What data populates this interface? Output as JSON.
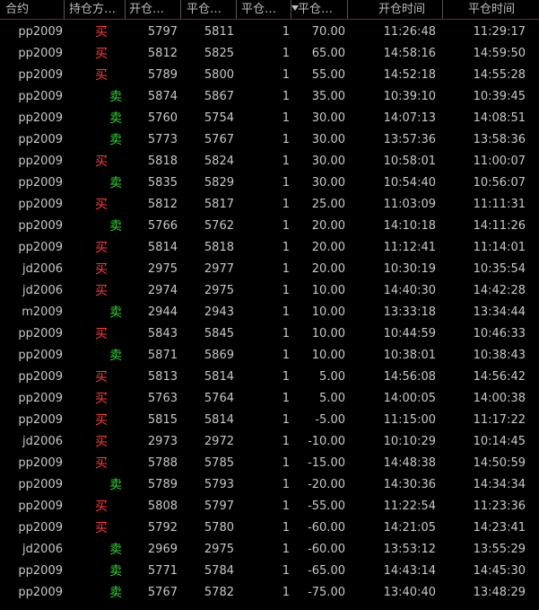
{
  "headers": {
    "contract": "合约",
    "direction": "持仓方…",
    "open_price": "开仓…",
    "close_price": "平仓…",
    "quantity": "平仓…",
    "pnl": "平仓…",
    "open_time": "开仓时间",
    "close_time": "平仓时间"
  },
  "icons": {
    "sort": "sort-descending-icon"
  },
  "colors": {
    "buy": "#ff3b3b",
    "sell": "#2fd32f",
    "header_border": "#8a1a1a"
  },
  "rows": [
    {
      "contract": "pp2009",
      "dir": "买",
      "side": "buy",
      "open": "5797",
      "close": "5811",
      "qty": "1",
      "pnl": "70.00",
      "otime": "11:26:48",
      "ctime": "11:29:17"
    },
    {
      "contract": "pp2009",
      "dir": "买",
      "side": "buy",
      "open": "5812",
      "close": "5825",
      "qty": "1",
      "pnl": "65.00",
      "otime": "14:58:16",
      "ctime": "14:59:50"
    },
    {
      "contract": "pp2009",
      "dir": "买",
      "side": "buy",
      "open": "5789",
      "close": "5800",
      "qty": "1",
      "pnl": "55.00",
      "otime": "14:52:18",
      "ctime": "14:55:28"
    },
    {
      "contract": "pp2009",
      "dir": "卖",
      "side": "sell",
      "open": "5874",
      "close": "5867",
      "qty": "1",
      "pnl": "35.00",
      "otime": "10:39:10",
      "ctime": "10:39:45"
    },
    {
      "contract": "pp2009",
      "dir": "卖",
      "side": "sell",
      "open": "5760",
      "close": "5754",
      "qty": "1",
      "pnl": "30.00",
      "otime": "14:07:13",
      "ctime": "14:08:51"
    },
    {
      "contract": "pp2009",
      "dir": "卖",
      "side": "sell",
      "open": "5773",
      "close": "5767",
      "qty": "1",
      "pnl": "30.00",
      "otime": "13:57:36",
      "ctime": "13:58:36"
    },
    {
      "contract": "pp2009",
      "dir": "买",
      "side": "buy",
      "open": "5818",
      "close": "5824",
      "qty": "1",
      "pnl": "30.00",
      "otime": "10:58:01",
      "ctime": "11:00:07"
    },
    {
      "contract": "pp2009",
      "dir": "卖",
      "side": "sell",
      "open": "5835",
      "close": "5829",
      "qty": "1",
      "pnl": "30.00",
      "otime": "10:54:40",
      "ctime": "10:56:07"
    },
    {
      "contract": "pp2009",
      "dir": "买",
      "side": "buy",
      "open": "5812",
      "close": "5817",
      "qty": "1",
      "pnl": "25.00",
      "otime": "11:03:09",
      "ctime": "11:11:31"
    },
    {
      "contract": "pp2009",
      "dir": "卖",
      "side": "sell",
      "open": "5766",
      "close": "5762",
      "qty": "1",
      "pnl": "20.00",
      "otime": "14:10:18",
      "ctime": "14:11:26"
    },
    {
      "contract": "pp2009",
      "dir": "买",
      "side": "buy",
      "open": "5814",
      "close": "5818",
      "qty": "1",
      "pnl": "20.00",
      "otime": "11:12:41",
      "ctime": "11:14:01"
    },
    {
      "contract": "jd2006",
      "dir": "买",
      "side": "buy",
      "open": "2975",
      "close": "2977",
      "qty": "1",
      "pnl": "20.00",
      "otime": "10:30:19",
      "ctime": "10:35:54"
    },
    {
      "contract": "jd2006",
      "dir": "买",
      "side": "buy",
      "open": "2974",
      "close": "2975",
      "qty": "1",
      "pnl": "10.00",
      "otime": "14:40:30",
      "ctime": "14:42:28"
    },
    {
      "contract": "m2009",
      "dir": "卖",
      "side": "sell",
      "open": "2944",
      "close": "2943",
      "qty": "1",
      "pnl": "10.00",
      "otime": "13:33:18",
      "ctime": "13:34:44"
    },
    {
      "contract": "pp2009",
      "dir": "买",
      "side": "buy",
      "open": "5843",
      "close": "5845",
      "qty": "1",
      "pnl": "10.00",
      "otime": "10:44:59",
      "ctime": "10:46:33"
    },
    {
      "contract": "pp2009",
      "dir": "卖",
      "side": "sell",
      "open": "5871",
      "close": "5869",
      "qty": "1",
      "pnl": "10.00",
      "otime": "10:38:01",
      "ctime": "10:38:43"
    },
    {
      "contract": "pp2009",
      "dir": "买",
      "side": "buy",
      "open": "5813",
      "close": "5814",
      "qty": "1",
      "pnl": "5.00",
      "otime": "14:56:08",
      "ctime": "14:56:42"
    },
    {
      "contract": "pp2009",
      "dir": "买",
      "side": "buy",
      "open": "5763",
      "close": "5764",
      "qty": "1",
      "pnl": "5.00",
      "otime": "14:00:05",
      "ctime": "14:00:38"
    },
    {
      "contract": "pp2009",
      "dir": "买",
      "side": "buy",
      "open": "5815",
      "close": "5814",
      "qty": "1",
      "pnl": "-5.00",
      "otime": "11:15:00",
      "ctime": "11:17:22"
    },
    {
      "contract": "jd2006",
      "dir": "买",
      "side": "buy",
      "open": "2973",
      "close": "2972",
      "qty": "1",
      "pnl": "-10.00",
      "otime": "10:10:29",
      "ctime": "10:14:45"
    },
    {
      "contract": "pp2009",
      "dir": "买",
      "side": "buy",
      "open": "5788",
      "close": "5785",
      "qty": "1",
      "pnl": "-15.00",
      "otime": "14:48:38",
      "ctime": "14:50:59"
    },
    {
      "contract": "pp2009",
      "dir": "卖",
      "side": "sell",
      "open": "5789",
      "close": "5793",
      "qty": "1",
      "pnl": "-20.00",
      "otime": "14:30:36",
      "ctime": "14:34:34"
    },
    {
      "contract": "pp2009",
      "dir": "买",
      "side": "buy",
      "open": "5808",
      "close": "5797",
      "qty": "1",
      "pnl": "-55.00",
      "otime": "11:22:54",
      "ctime": "11:23:36"
    },
    {
      "contract": "pp2009",
      "dir": "买",
      "side": "buy",
      "open": "5792",
      "close": "5780",
      "qty": "1",
      "pnl": "-60.00",
      "otime": "14:21:05",
      "ctime": "14:23:41"
    },
    {
      "contract": "jd2006",
      "dir": "卖",
      "side": "sell",
      "open": "2969",
      "close": "2975",
      "qty": "1",
      "pnl": "-60.00",
      "otime": "13:53:12",
      "ctime": "13:55:29"
    },
    {
      "contract": "pp2009",
      "dir": "卖",
      "side": "sell",
      "open": "5771",
      "close": "5784",
      "qty": "1",
      "pnl": "-65.00",
      "otime": "14:43:14",
      "ctime": "14:45:30"
    },
    {
      "contract": "pp2009",
      "dir": "卖",
      "side": "sell",
      "open": "5767",
      "close": "5782",
      "qty": "1",
      "pnl": "-75.00",
      "otime": "13:40:40",
      "ctime": "13:48:29"
    }
  ]
}
